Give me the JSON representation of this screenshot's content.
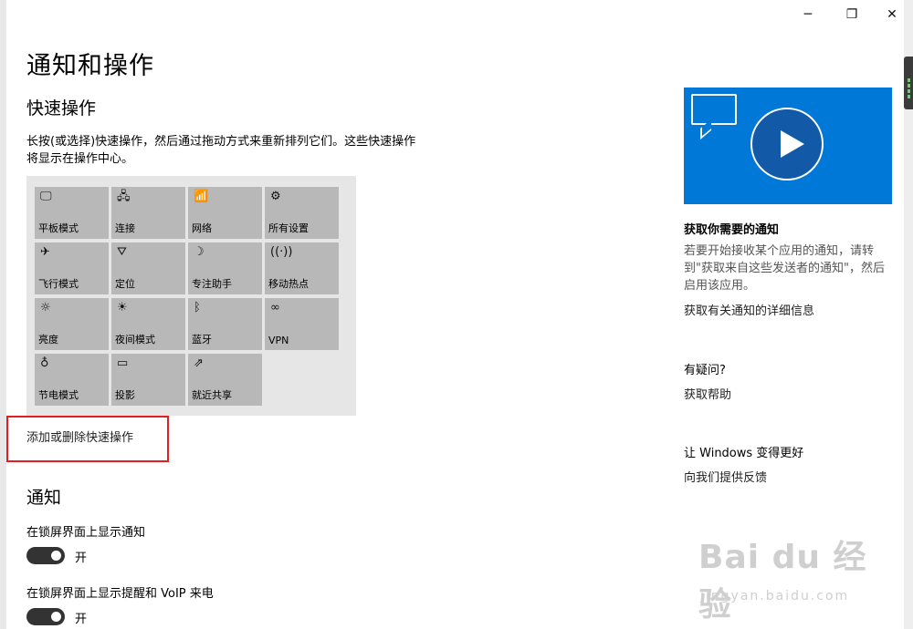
{
  "window": {
    "controls": {
      "minimize": "─",
      "maximize": "❐",
      "close": "✕"
    }
  },
  "page": {
    "title": "通知和操作",
    "quick_actions": {
      "heading": "快速操作",
      "description": "长按(或选择)快速操作，然后通过拖动方式来重新排列它们。这些快速操作将显示在操作中心。",
      "tiles": [
        {
          "label": "平板模式",
          "icon": "tablet-mode-icon",
          "glyph": "🖵"
        },
        {
          "label": "连接",
          "icon": "connect-icon",
          "glyph": "🖧"
        },
        {
          "label": "网络",
          "icon": "network-icon",
          "glyph": "📶"
        },
        {
          "label": "所有设置",
          "icon": "gear-icon",
          "glyph": "⚙"
        },
        {
          "label": "飞行模式",
          "icon": "airplane-icon",
          "glyph": "✈"
        },
        {
          "label": "定位",
          "icon": "location-icon",
          "glyph": "⛛"
        },
        {
          "label": "专注助手",
          "icon": "moon-icon",
          "glyph": "☽"
        },
        {
          "label": "移动热点",
          "icon": "hotspot-icon",
          "glyph": "((·))"
        },
        {
          "label": "亮度",
          "icon": "brightness-icon",
          "glyph": "☼"
        },
        {
          "label": "夜间模式",
          "icon": "night-light-icon",
          "glyph": "☀"
        },
        {
          "label": "蓝牙",
          "icon": "bluetooth-icon",
          "glyph": "ᛒ"
        },
        {
          "label": "VPN",
          "icon": "vpn-icon",
          "glyph": "∞"
        },
        {
          "label": "节电模式",
          "icon": "battery-saver-icon",
          "glyph": "♁"
        },
        {
          "label": "投影",
          "icon": "project-icon",
          "glyph": "▭"
        },
        {
          "label": "就近共享",
          "icon": "nearby-share-icon",
          "glyph": "⇗"
        }
      ],
      "add_remove_link": "添加或删除快速操作"
    },
    "notifications": {
      "heading": "通知",
      "lock_screen_label": "在锁屏界面上显示通知",
      "lock_screen_state": "开",
      "voip_label": "在锁屏界面上显示提醒和 VoIP 来电",
      "voip_state": "开"
    }
  },
  "sidebar": {
    "get_notifications_title": "获取你需要的通知",
    "get_notifications_text": "若要开始接收某个应用的通知，请转到\"获取来自这些发送者的通知\"，然后启用该应用。",
    "more_info_link": "获取有关通知的详细信息",
    "questions_title": "有疑问?",
    "help_link": "获取帮助",
    "improve_title": "让 Windows 变得更好",
    "feedback_link": "向我们提供反馈"
  },
  "watermark": {
    "main": "Bai du 经验",
    "sub": "jingyan.baidu.com"
  },
  "colors": {
    "accent": "#0078d7",
    "tile_bg": "#b8b8b8",
    "panel_bg": "#e6e6e6",
    "highlight": "#e02020"
  }
}
